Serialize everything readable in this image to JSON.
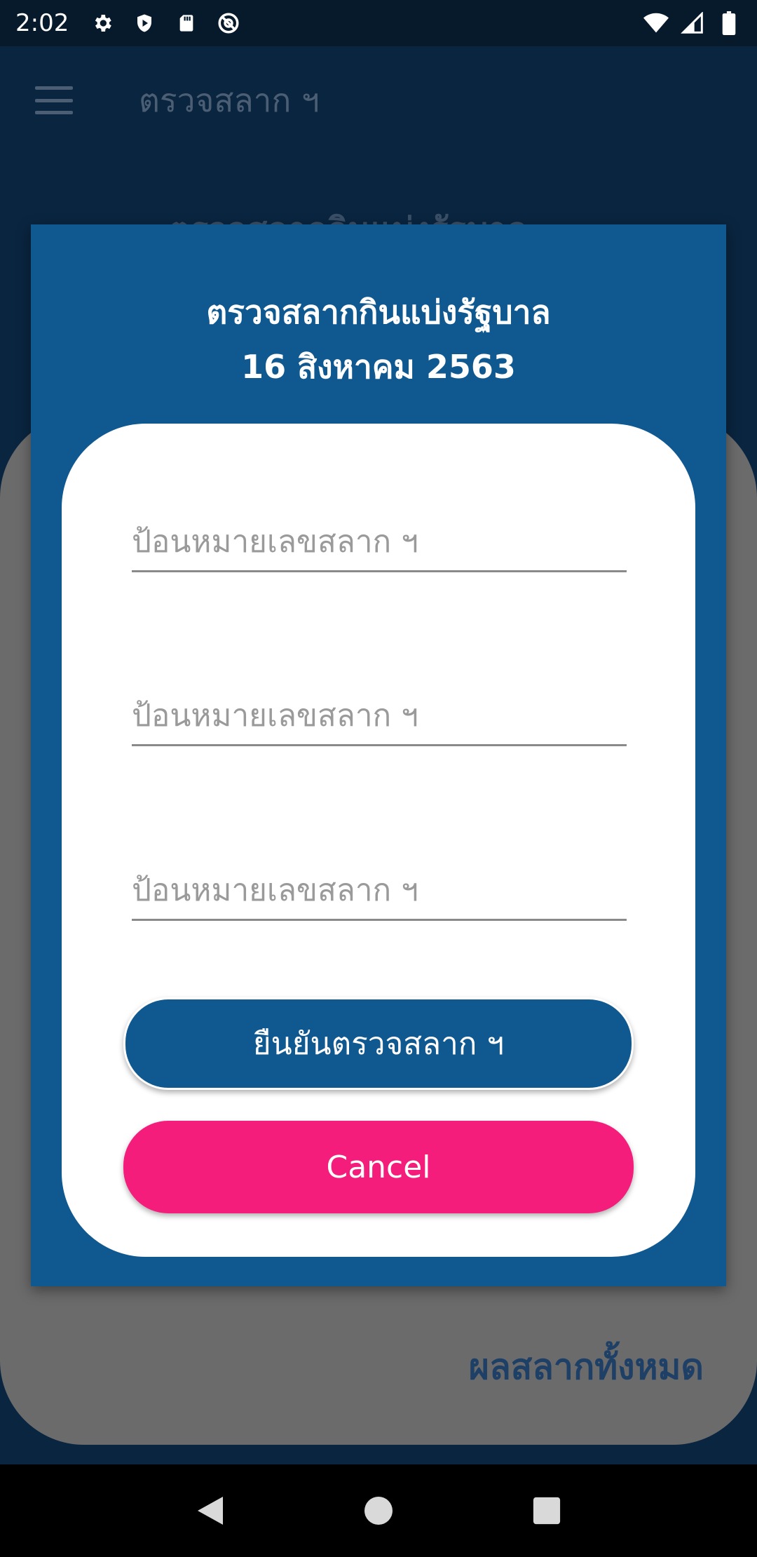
{
  "status_bar": {
    "time": "2:02",
    "left_icons": [
      "gear-icon",
      "shield-icon",
      "sd-card-icon",
      "at-sign-icon"
    ],
    "right_icons": [
      "wifi-icon",
      "signal-icon",
      "battery-icon"
    ]
  },
  "app_bar": {
    "title": "ตรวจสลาก ฯ"
  },
  "page_behind": {
    "heading": "ตรวจสลากกินแบ่งรัฐบาล",
    "link": "ผลสลากทั้งหมด"
  },
  "dialog": {
    "title_line1": "ตรวจสลากกินแบ่งรัฐบาล",
    "title_line2": "16 สิงหาคม 2563",
    "fields": [
      {
        "placeholder": "ป้อนหมายเลขสลาก ฯ",
        "value": ""
      },
      {
        "placeholder": "ป้อนหมายเลขสลาก ฯ",
        "value": ""
      },
      {
        "placeholder": "ป้อนหมายเลขสลาก ฯ",
        "value": ""
      }
    ],
    "confirm_label": "ยืนยันตรวจสลาก ฯ",
    "cancel_label": "Cancel"
  },
  "colors": {
    "dialog_bg": "#0f5890",
    "confirm_bg": "#0f5890",
    "cancel_bg": "#f51d7b",
    "app_bar_bg": "#0a2540"
  },
  "nav_bar": {
    "icons": [
      "back-icon",
      "home-icon",
      "recents-icon"
    ]
  }
}
